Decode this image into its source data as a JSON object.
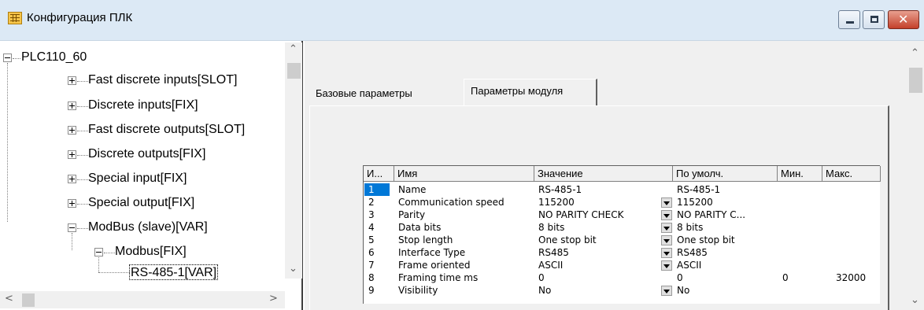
{
  "window": {
    "title": "Конфигурация ПЛК"
  },
  "tree": {
    "root": "PLC110_60",
    "items": [
      "Fast discrete inputs[SLOT]",
      "Discrete inputs[FIX]",
      "Fast discrete outputs[SLOT]",
      "Discrete outputs[FIX]",
      "Special input[FIX]",
      "Special output[FIX]",
      "ModBus (slave)[VAR]"
    ],
    "modbus_child": "Modbus[FIX]",
    "leaf": "RS-485-1[VAR]"
  },
  "tabs": {
    "base": "Базовые параметры",
    "module": "Параметры модуля"
  },
  "grid": {
    "headers": [
      "И...",
      "Имя",
      "Значение",
      "По умолч.",
      "Мин.",
      "Макс."
    ],
    "rows": [
      {
        "idx": "1",
        "name": "Name",
        "value": "RS-485-1",
        "default": "RS-485-1",
        "min": "",
        "max": "",
        "dropdown": false
      },
      {
        "idx": "2",
        "name": "Communication speed",
        "value": "115200",
        "default": "115200",
        "min": "",
        "max": "",
        "dropdown": true
      },
      {
        "idx": "3",
        "name": "Parity",
        "value": "NO PARITY CHECK",
        "default": "NO PARITY C...",
        "min": "",
        "max": "",
        "dropdown": true
      },
      {
        "idx": "4",
        "name": "Data bits",
        "value": "8 bits",
        "default": "8 bits",
        "min": "",
        "max": "",
        "dropdown": true
      },
      {
        "idx": "5",
        "name": "Stop length",
        "value": "One stop bit",
        "default": "One stop bit",
        "min": "",
        "max": "",
        "dropdown": true
      },
      {
        "idx": "6",
        "name": "Interface Type",
        "value": "RS485",
        "default": "RS485",
        "min": "",
        "max": "",
        "dropdown": true
      },
      {
        "idx": "7",
        "name": "Frame oriented",
        "value": "ASCII",
        "default": "ASCII",
        "min": "",
        "max": "",
        "dropdown": true
      },
      {
        "idx": "8",
        "name": "Framing time ms",
        "value": "0",
        "default": "0",
        "min": "0",
        "max": "32000",
        "dropdown": false
      },
      {
        "idx": "9",
        "name": "Visibility",
        "value": "No",
        "default": "No",
        "min": "",
        "max": "",
        "dropdown": true
      }
    ]
  },
  "colors": {
    "selection": "#0078d7",
    "titlebar": "#dce9f5"
  }
}
